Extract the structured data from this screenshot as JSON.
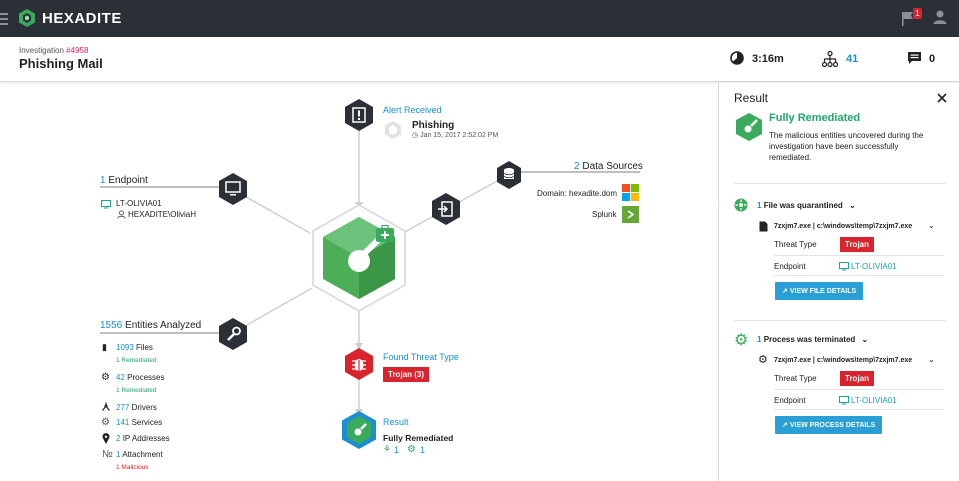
{
  "brand": "HEXADITE",
  "notifications_count": "1",
  "investigation": {
    "label": "Investigation",
    "number": "#4958",
    "title": "Phishing Mail"
  },
  "stats": {
    "duration": "3:16m",
    "entities": "41",
    "comments": "0"
  },
  "graph": {
    "alert": {
      "title": "Alert Received",
      "name": "Phishing",
      "date": "Jan 15, 2017 2:52:02 PM"
    },
    "endpoint": {
      "count": "1",
      "label": "Endpoint",
      "host": "LT-OLIVIA01",
      "user": "HEXADITE\\OliviaH"
    },
    "data_sources": {
      "count": "2",
      "label": "Data Sources",
      "domain": "Domain: hexadite.dom",
      "splunk": "Splunk"
    },
    "entities": {
      "count": "1556",
      "label": "Entities Analyzed",
      "files": {
        "count": "1093",
        "label": "Files",
        "note": "1 Remediated"
      },
      "processes": {
        "count": "42",
        "label": "Processes",
        "note": "1 Remediated"
      },
      "drivers": {
        "count": "277",
        "label": "Drivers"
      },
      "services": {
        "count": "141",
        "label": "Services"
      },
      "ips": {
        "count": "2",
        "label": "IP Addresses"
      },
      "attachment": {
        "count": "1",
        "label": "Attachment",
        "note": "1 Malicious"
      }
    },
    "threat": {
      "title": "Found Threat Type",
      "tag": "Trojan (3)"
    },
    "result": {
      "title": "Result",
      "status": "Fully Remediated",
      "count_a": "1",
      "count_b": "1"
    }
  },
  "panel": {
    "title": "Result",
    "status": "Fully Remediated",
    "description_1": "The malicious entities uncovered during the",
    "description_2": "investigation have been successfully",
    "description_3": "remediated.",
    "file_section": {
      "count": "1",
      "label": "File was quarantined",
      "path": "7zxjm7.exe | c:\\windows\\temp\\7zxjm7.exe",
      "threat_label": "Threat Type",
      "threat": "Trojan",
      "endpoint_label": "Endpoint",
      "endpoint": "LT-OLIVIA01",
      "button": "VIEW FILE DETAILS"
    },
    "process_section": {
      "count": "1",
      "label": "Process was terminated",
      "path": "7zxjm7.exe | c:\\windows\\temp\\7zxjm7.exe",
      "threat_label": "Threat Type",
      "threat": "Trojan",
      "endpoint_label": "Endpoint",
      "endpoint": "LT-OLIVIA01",
      "button": "VIEW PROCESS DETAILS"
    }
  },
  "colors": {
    "topbar": "#2b2f36",
    "accent_green": "#3aaa5c",
    "link_blue": "#1d8fd0",
    "alert_red": "#d9232d"
  }
}
